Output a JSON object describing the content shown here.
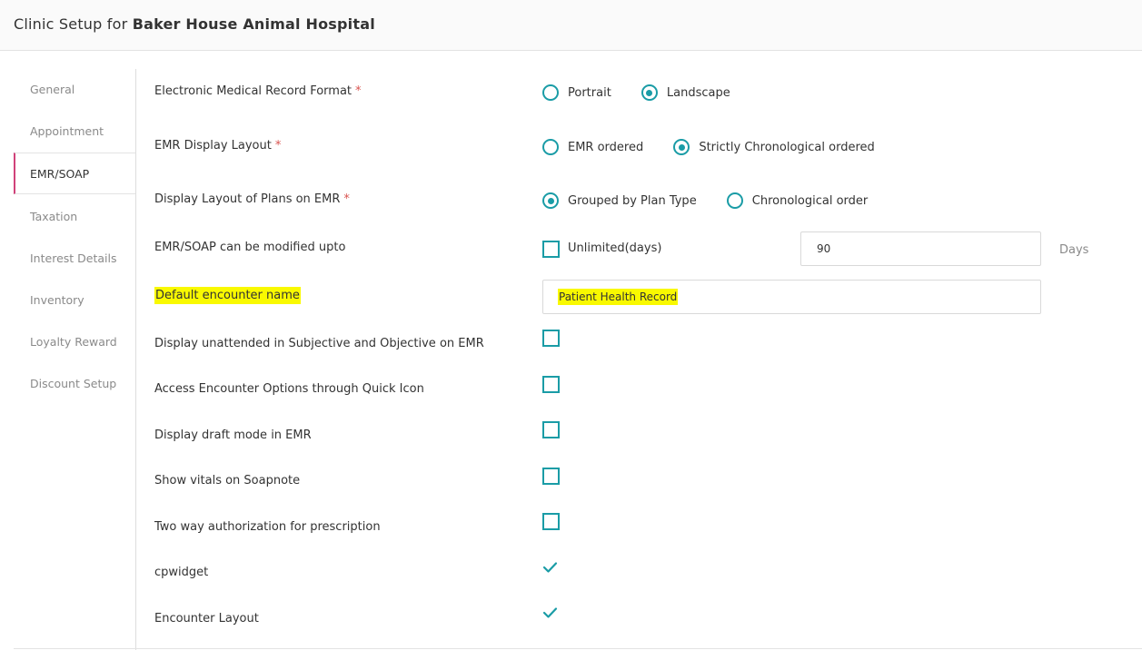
{
  "header": {
    "prefix": "Clinic Setup for ",
    "clinic_name": "Baker House Animal Hospital"
  },
  "sidebar": {
    "active": "EMR/SOAP",
    "items": [
      {
        "label": "General"
      },
      {
        "label": "Appointment"
      },
      {
        "label": "EMR/SOAP"
      },
      {
        "label": "Taxation"
      },
      {
        "label": "Interest Details"
      },
      {
        "label": "Inventory"
      },
      {
        "label": "Loyalty Reward"
      },
      {
        "label": "Discount Setup"
      }
    ]
  },
  "required_mark": "*",
  "colors": {
    "accent": "#1a9ca6",
    "active_indicator": "#d0427a",
    "highlight": "#f9f900",
    "required": "#d9534f"
  },
  "settings": {
    "emr_format": {
      "label": "Electronic Medical Record Format",
      "options": [
        {
          "label": "Portrait",
          "selected": false
        },
        {
          "label": "Landscape",
          "selected": true
        }
      ]
    },
    "emr_display_layout": {
      "label": "EMR Display Layout",
      "options": [
        {
          "label": "EMR ordered",
          "selected": false
        },
        {
          "label": "Strictly Chronological ordered",
          "selected": true
        }
      ]
    },
    "plans_layout": {
      "label": "Display Layout of Plans on EMR",
      "options": [
        {
          "label": "Grouped by Plan Type",
          "selected": true
        },
        {
          "label": "Chronological order",
          "selected": false
        }
      ]
    },
    "modify_upto": {
      "label": "EMR/SOAP can be modified upto",
      "unlimited_label": "Unlimited(days)",
      "unlimited_checked": false,
      "value": "90",
      "suffix": "Days"
    },
    "encounter_name": {
      "label": "Default encounter name",
      "value": "Patient Health Record"
    },
    "display_unattended": {
      "label": "Display unattended in Subjective and Objective on EMR",
      "checked": false
    },
    "quick_icon": {
      "label": "Access Encounter Options through Quick Icon",
      "checked": false
    },
    "draft_mode": {
      "label": "Display draft mode in EMR",
      "checked": false
    },
    "vitals": {
      "label": "Show vitals on Soapnote",
      "checked": false
    },
    "two_way_auth": {
      "label": "Two way authorization for prescription",
      "checked": false
    },
    "cpwidget": {
      "label": "cpwidget",
      "checked": true
    },
    "encounter_layout": {
      "label": "Encounter Layout",
      "checked": true
    }
  }
}
